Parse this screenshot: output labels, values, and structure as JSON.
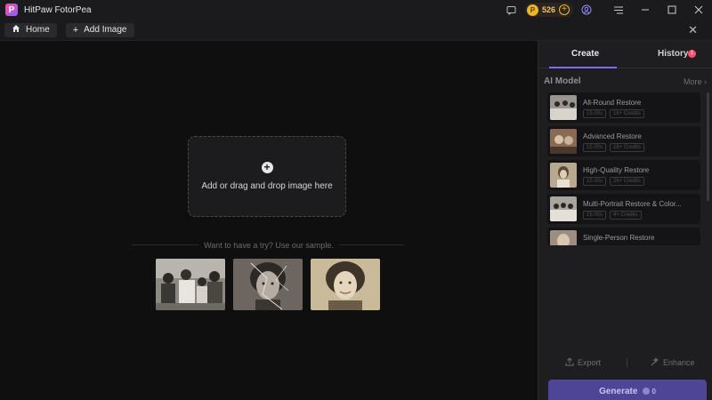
{
  "app": {
    "title": "HitPaw FotorPea",
    "logo_letter": "P"
  },
  "titlebar": {
    "credits": "526"
  },
  "tabs": {
    "home_label": "Home",
    "add_image_label": "Add Image"
  },
  "main": {
    "dropzone_text": "Add or drag and drop image here",
    "sample_prompt": "Want to have a try? Use our sample."
  },
  "panel": {
    "tab_create": "Create",
    "tab_history": "History",
    "history_badge": "1",
    "ai_model_label": "AI Model",
    "more_label": "More",
    "models": [
      {
        "name": "All-Round Restore",
        "time": "15.00s",
        "credits": "16+ Credits"
      },
      {
        "name": "Advanced Restore",
        "time": "15.00s",
        "credits": "16+ Credits"
      },
      {
        "name": "High-Quality Restore",
        "time": "15.00s",
        "credits": "26+ Credits"
      },
      {
        "name": "Multi-Portrait Restore & Color...",
        "time": "15.00s",
        "credits": "4+ Credits"
      },
      {
        "name": "Single-Person Restore",
        "time": "",
        "credits": ""
      }
    ],
    "export_label": "Export",
    "enhance_label": "Enhance",
    "generate_label": "Generate",
    "generate_cost": "0"
  },
  "colors": {
    "accent": "#7b6cf6",
    "generate": "#4e4597",
    "coin": "#f0b429",
    "badge": "#ff4d6d"
  }
}
